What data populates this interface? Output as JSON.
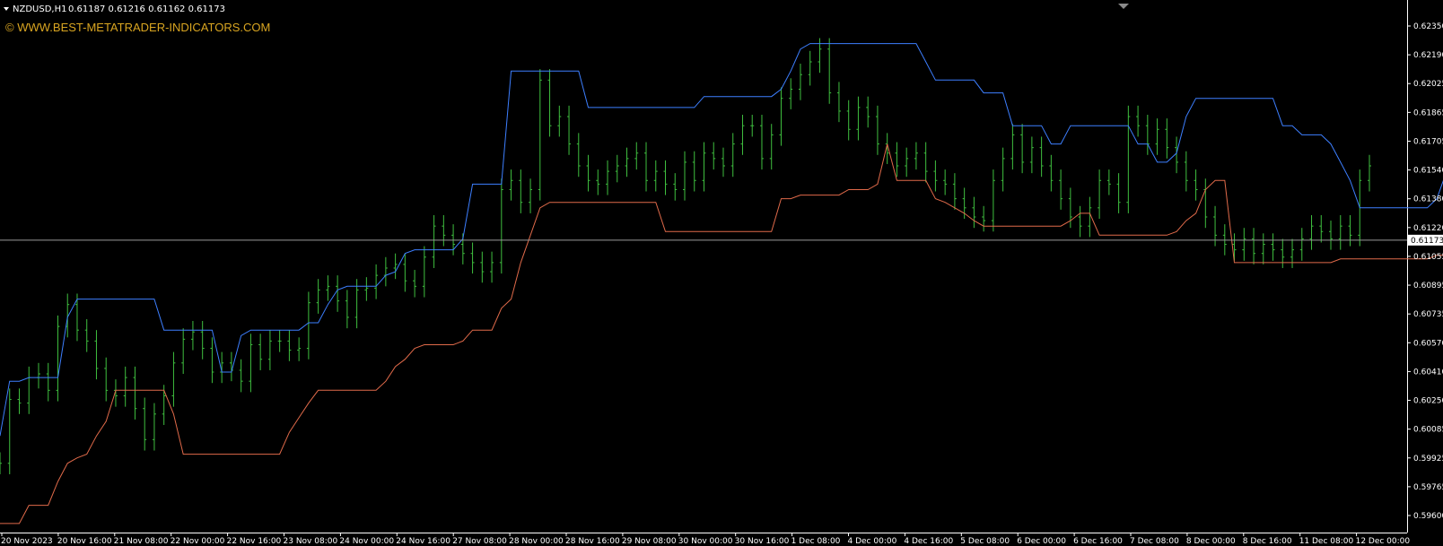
{
  "header": {
    "symbol_timeframe": "NZDUSD,H1",
    "ohlc": "0.61187 0.61216 0.61162 0.61173"
  },
  "watermark": "© WWW.BEST-METATRADER-INDICATORS.COM",
  "colors": {
    "background": "#000000",
    "bars": "#3fbf3f",
    "upper_band": "#3d7fff",
    "lower_band": "#e06a4a",
    "price_line": "#9a9a9a",
    "axis": "#ffffff",
    "watermark": "#d9a521"
  },
  "icons": {
    "menu": "triangle-down-icon",
    "shift_marker": "triangle-down-icon"
  },
  "chart_data": {
    "type": "line",
    "ylim": [
      0.596,
      0.6243
    ],
    "y_ticks": [
      "0.62350",
      "0.62190",
      "0.62025",
      "0.61865",
      "0.61705",
      "0.61540",
      "0.61380",
      "0.61220",
      "0.61055",
      "0.60895",
      "0.60735",
      "0.60570",
      "0.60410",
      "0.60250",
      "0.60085",
      "0.59925",
      "0.59765",
      "0.59600"
    ],
    "x_ticks": [
      "20 Nov 2023",
      "20 Nov 16:00",
      "21 Nov 08:00",
      "22 Nov 00:00",
      "22 Nov 16:00",
      "23 Nov 08:00",
      "24 Nov 00:00",
      "24 Nov 16:00",
      "27 Nov 08:00",
      "28 Nov 00:00",
      "28 Nov 16:00",
      "29 Nov 08:00",
      "30 Nov 00:00",
      "30 Nov 16:00",
      "1 Dec 08:00",
      "4 Dec 00:00",
      "4 Dec 16:00",
      "5 Dec 08:00",
      "6 Dec 00:00",
      "6 Dec 16:00",
      "7 Dec 08:00",
      "8 Dec 00:00",
      "8 Dec 16:00",
      "11 Dec 08:00",
      "12 Dec 00:00"
    ],
    "current_price": "0.61173",
    "current_price_value": 0.61173,
    "price_series": [
      0.5995,
      0.603,
      0.6028,
      0.6042,
      0.6044,
      0.6035,
      0.607,
      0.6082,
      0.6068,
      0.6062,
      0.6047,
      0.6035,
      0.6032,
      0.6042,
      0.6025,
      0.6008,
      0.6022,
      0.6032,
      0.605,
      0.6063,
      0.6067,
      0.6058,
      0.6045,
      0.605,
      0.6046,
      0.604,
      0.606,
      0.6052,
      0.6062,
      0.6062,
      0.6057,
      0.6058,
      0.6083,
      0.609,
      0.6092,
      0.6084,
      0.6075,
      0.609,
      0.6091,
      0.6098,
      0.6102,
      0.6104,
      0.6095,
      0.6092,
      0.6108,
      0.6125,
      0.612,
      0.6115,
      0.611,
      0.6105,
      0.61,
      0.6105,
      0.6145,
      0.615,
      0.6138,
      0.6145,
      0.6205,
      0.618,
      0.6185,
      0.617,
      0.6158,
      0.615,
      0.6148,
      0.6155,
      0.6158,
      0.6162,
      0.6165,
      0.615,
      0.6155,
      0.6148,
      0.6145,
      0.616,
      0.615,
      0.6165,
      0.6162,
      0.6158,
      0.617,
      0.618,
      0.618,
      0.6162,
      0.6175,
      0.6195,
      0.62,
      0.6208,
      0.6215,
      0.6222,
      0.6198,
      0.6188,
      0.6178,
      0.619,
      0.6185,
      0.617,
      0.6165,
      0.6158,
      0.6162,
      0.6165,
      0.6155,
      0.615,
      0.6148,
      0.614,
      0.6135,
      0.613,
      0.6128,
      0.615,
      0.6162,
      0.6175,
      0.616,
      0.6168,
      0.6158,
      0.615,
      0.614,
      0.613,
      0.6125,
      0.6135,
      0.615,
      0.6148,
      0.6138,
      0.6185,
      0.618,
      0.617,
      0.6178,
      0.6168,
      0.616,
      0.615,
      0.6145,
      0.613,
      0.612,
      0.6115,
      0.6112,
      0.6118,
      0.611,
      0.6115,
      0.6112,
      0.6108,
      0.6112,
      0.6118,
      0.6125,
      0.6122,
      0.6118,
      0.6125,
      0.612,
      0.615,
      0.6158
    ],
    "upper_band": [
      0.601,
      0.604,
      0.604,
      0.6042,
      0.6042,
      0.6042,
      0.6042,
      0.6075,
      0.6085,
      0.6085,
      0.6085,
      0.6085,
      0.6085,
      0.6085,
      0.6085,
      0.6085,
      0.6085,
      0.6068,
      0.6068,
      0.6068,
      0.6068,
      0.6068,
      0.6068,
      0.6045,
      0.6045,
      0.6065,
      0.6068,
      0.6068,
      0.6068,
      0.6068,
      0.6068,
      0.6068,
      0.6072,
      0.6072,
      0.6082,
      0.609,
      0.6092,
      0.6092,
      0.6092,
      0.6092,
      0.6098,
      0.61,
      0.611,
      0.6112,
      0.6112,
      0.6112,
      0.6112,
      0.6112,
      0.6118,
      0.6148,
      0.6148,
      0.6148,
      0.6148,
      0.621,
      0.621,
      0.621,
      0.621,
      0.621,
      0.621,
      0.621,
      0.621,
      0.619,
      0.619,
      0.619,
      0.619,
      0.619,
      0.619,
      0.619,
      0.619,
      0.619,
      0.619,
      0.619,
      0.619,
      0.6196,
      0.6196,
      0.6196,
      0.6196,
      0.6196,
      0.6196,
      0.6196,
      0.6196,
      0.62,
      0.621,
      0.6222,
      0.6225,
      0.6225,
      0.6225,
      0.6225,
      0.6225,
      0.6225,
      0.6225,
      0.6225,
      0.6225,
      0.6225,
      0.6225,
      0.6225,
      0.6215,
      0.6205,
      0.6205,
      0.6205,
      0.6205,
      0.6205,
      0.6198,
      0.6198,
      0.6198,
      0.618,
      0.618,
      0.618,
      0.618,
      0.617,
      0.617,
      0.618,
      0.618,
      0.618,
      0.618,
      0.618,
      0.618,
      0.618,
      0.617,
      0.617,
      0.616,
      0.616,
      0.6165,
      0.6185,
      0.6195,
      0.6195,
      0.6195,
      0.6195,
      0.6195,
      0.6195,
      0.6195,
      0.6195,
      0.6195,
      0.618,
      0.618,
      0.6175,
      0.6175,
      0.6175,
      0.617,
      0.616,
      0.615,
      0.6135,
      0.6135,
      0.6135,
      0.6135,
      0.6135,
      0.6135,
      0.6135,
      0.6135,
      0.614,
      0.6155
    ],
    "lower_band": [
      0.5962,
      0.5962,
      0.5962,
      0.5972,
      0.5972,
      0.5972,
      0.5985,
      0.5995,
      0.5998,
      0.6,
      0.601,
      0.6018,
      0.6035,
      0.6035,
      0.6035,
      0.6035,
      0.6035,
      0.6035,
      0.6022,
      0.6,
      0.6,
      0.6,
      0.6,
      0.6,
      0.6,
      0.6,
      0.6,
      0.6,
      0.6,
      0.6,
      0.6012,
      0.602,
      0.6028,
      0.6035,
      0.6035,
      0.6035,
      0.6035,
      0.6035,
      0.6035,
      0.6035,
      0.604,
      0.6048,
      0.6052,
      0.6058,
      0.606,
      0.606,
      0.606,
      0.606,
      0.6062,
      0.6068,
      0.6068,
      0.6068,
      0.608,
      0.6085,
      0.6105,
      0.612,
      0.6135,
      0.6138,
      0.6138,
      0.6138,
      0.6138,
      0.6138,
      0.6138,
      0.6138,
      0.6138,
      0.6138,
      0.6138,
      0.6138,
      0.6138,
      0.6122,
      0.6122,
      0.6122,
      0.6122,
      0.6122,
      0.6122,
      0.6122,
      0.6122,
      0.6122,
      0.6122,
      0.6122,
      0.6122,
      0.614,
      0.614,
      0.6142,
      0.6142,
      0.6142,
      0.6142,
      0.6142,
      0.6145,
      0.6145,
      0.6145,
      0.6148,
      0.617,
      0.615,
      0.615,
      0.615,
      0.615,
      0.614,
      0.6138,
      0.6135,
      0.6132,
      0.6128,
      0.6125,
      0.6125,
      0.6125,
      0.6125,
      0.6125,
      0.6125,
      0.6125,
      0.6125,
      0.6125,
      0.6128,
      0.6132,
      0.6132,
      0.612,
      0.612,
      0.612,
      0.612,
      0.612,
      0.612,
      0.612,
      0.612,
      0.6122,
      0.6128,
      0.6132,
      0.6145,
      0.615,
      0.615,
      0.6105,
      0.6105,
      0.6105,
      0.6105,
      0.6105,
      0.6105,
      0.6105,
      0.6105,
      0.6105,
      0.6105,
      0.6105,
      0.6107,
      0.6107,
      0.6107,
      0.6107,
      0.6107,
      0.6107,
      0.6107,
      0.6107,
      0.6107,
      0.6107,
      0.6109,
      0.6109
    ]
  }
}
